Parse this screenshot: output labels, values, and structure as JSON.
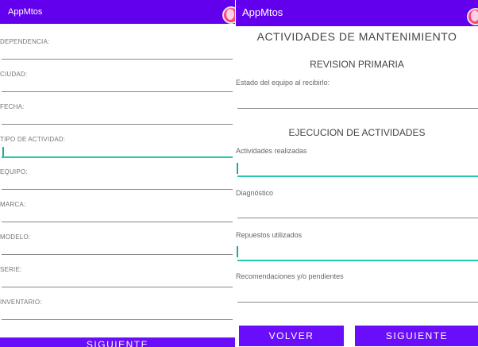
{
  "left": {
    "app_title": "AppMtos",
    "fields": [
      {
        "label": "DEPENDENCIA:"
      },
      {
        "label": "CIUDAD:"
      },
      {
        "label": "FECHA:"
      },
      {
        "label": "TIPO DE ACTIVIDAD:"
      },
      {
        "label": "EQUIPO:"
      },
      {
        "label": "MARCA:"
      },
      {
        "label": "MODELO:"
      },
      {
        "label": "SERIE:"
      },
      {
        "label": "INVENTARIO:"
      }
    ],
    "next_label": "SIGUIENTE"
  },
  "right": {
    "app_title": "AppMtos",
    "title": "ACTIVIDADES DE MANTENIMIENTO",
    "section1": "REVISION PRIMARIA",
    "estado_label": "Estado del equipo al recibirlo:",
    "section2": "EJECUCION DE ACTIVIDADES",
    "fields": [
      {
        "label": "Actividades realizadas"
      },
      {
        "label": "Diagnóstico"
      },
      {
        "label": "Repuestos utilizados"
      },
      {
        "label": "Recomendaciones y/o pendientes"
      }
    ],
    "back_label": "VOLVER",
    "next_label": "SIGUIENTE"
  },
  "colors": {
    "primary": "#6200ee",
    "accent": "#ff4081",
    "focus": "#26c6b0"
  }
}
